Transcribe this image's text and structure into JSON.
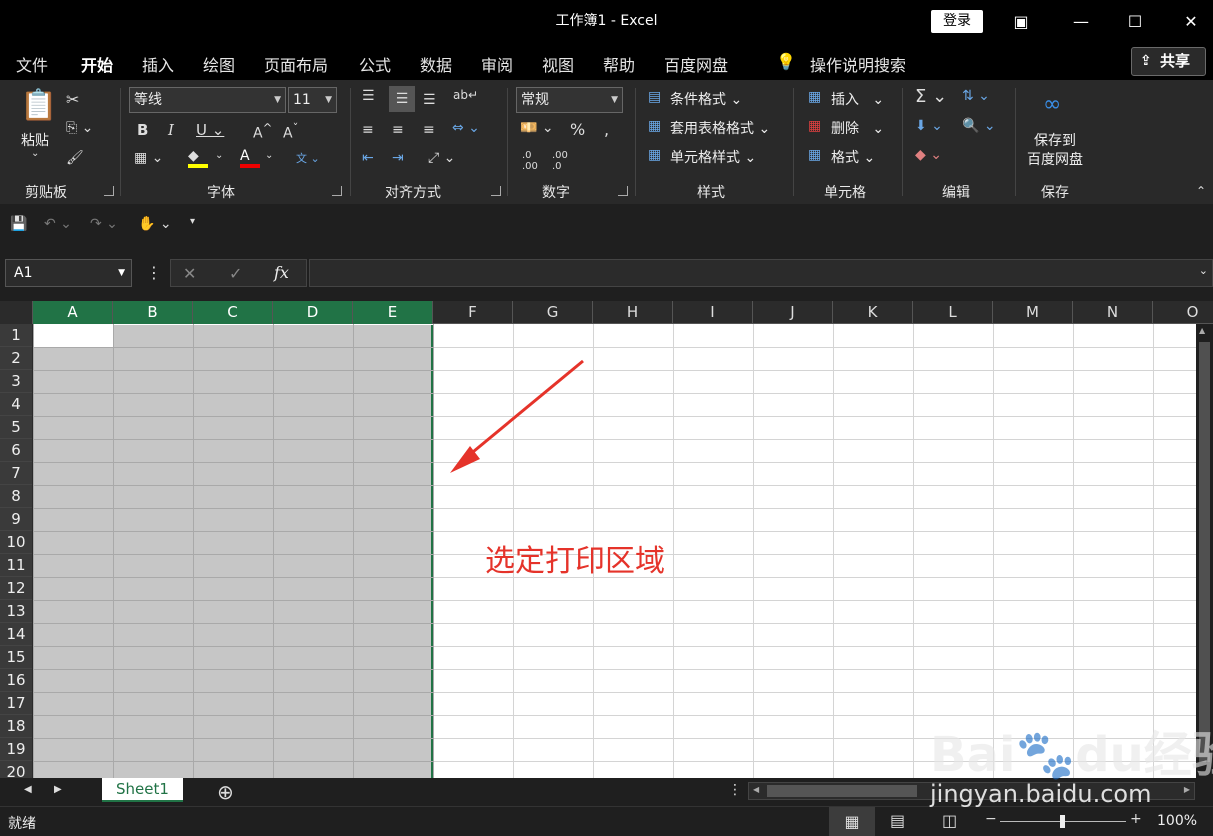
{
  "window": {
    "title": "工作簿1  -  Excel",
    "login": "登录"
  },
  "tabs": [
    {
      "label": "文件"
    },
    {
      "label": "开始"
    },
    {
      "label": "插入"
    },
    {
      "label": "绘图"
    },
    {
      "label": "页面布局"
    },
    {
      "label": "公式"
    },
    {
      "label": "数据"
    },
    {
      "label": "审阅"
    },
    {
      "label": "视图"
    },
    {
      "label": "帮助"
    },
    {
      "label": "百度网盘"
    },
    {
      "label": "操作说明搜索"
    }
  ],
  "share": "共享",
  "ribbon": {
    "paste": "粘贴",
    "font_name": "等线",
    "font_size": "11",
    "number_format": "常规",
    "cond_format": "条件格式",
    "table_format": "套用表格格式",
    "cell_style": "单元格样式",
    "insert": "插入",
    "delete": "删除",
    "format": "格式",
    "save_to": "保存到",
    "baidu_disk": "百度网盘",
    "groups": {
      "clipboard": "剪贴板",
      "font": "字体",
      "align": "对齐方式",
      "number": "数字",
      "styles": "样式",
      "cells": "单元格",
      "edit": "编辑",
      "save": "保存"
    }
  },
  "namebox": "A1",
  "fx": "fx",
  "columns": [
    "A",
    "B",
    "C",
    "D",
    "E",
    "F",
    "G",
    "H",
    "I",
    "J",
    "K",
    "L",
    "M",
    "N",
    "O"
  ],
  "rows": [
    "1",
    "2",
    "3",
    "4",
    "5",
    "6",
    "7",
    "8",
    "9",
    "10",
    "11",
    "12",
    "13",
    "14",
    "15",
    "16",
    "17",
    "18",
    "19",
    "20"
  ],
  "annotation": "选定打印区域",
  "sheet": "Sheet1",
  "status": {
    "ready": "就绪",
    "zoom": "100%"
  },
  "watermark": {
    "logo": "Baidu经验",
    "url": "jingyan.baidu.com"
  },
  "colors": {
    "accent": "#217346",
    "annotation": "#e5332a"
  }
}
